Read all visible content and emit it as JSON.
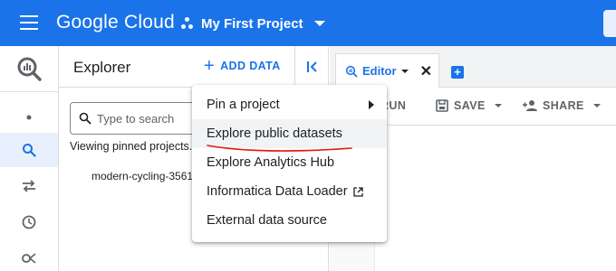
{
  "header": {
    "logo_google": "Google",
    "logo_cloud": "Cloud",
    "project_name": "My First Project"
  },
  "explorer": {
    "title": "Explorer",
    "add_data_label": "ADD DATA",
    "search_placeholder": "Type to search",
    "viewing_text": "Viewing pinned projects.",
    "project_item": "modern-cycling-3561"
  },
  "editor": {
    "tab_label": "Editor",
    "toolbar": {
      "run_label": "RUN",
      "save_label": "SAVE",
      "share_label": "SHARE"
    }
  },
  "menu": {
    "items": [
      {
        "label": "Pin a project",
        "has_submenu": true
      },
      {
        "label": "Explore public datasets",
        "highlighted": true
      },
      {
        "label": "Explore Analytics Hub"
      },
      {
        "label": "Informatica Data Loader",
        "external": true
      },
      {
        "label": "External data source"
      }
    ]
  },
  "colors": {
    "brand_blue": "#1a73e8",
    "annotation_red": "#e8180c"
  },
  "icons": {
    "menu": "hamburger-icon",
    "project": "project-dots-icon",
    "search": "search-icon",
    "collapse": "collapse-panel-icon",
    "add": "plus-icon",
    "external": "external-link-icon"
  }
}
